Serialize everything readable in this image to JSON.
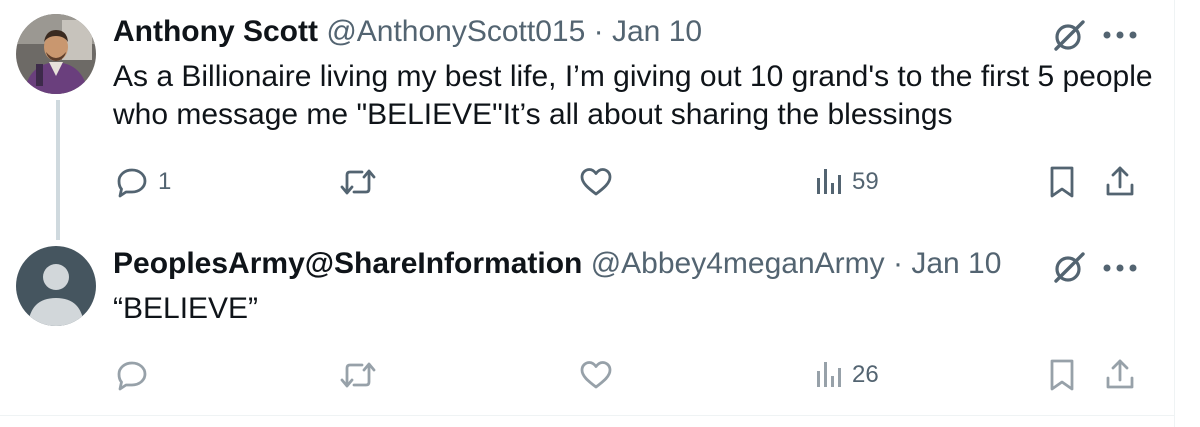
{
  "tweets": [
    {
      "author_name": "Anthony Scott",
      "handle": "@AnthonyScott015",
      "separator": "·",
      "date": "Jan 10",
      "text": "As a Billionaire living my best life, I’m giving out 10 grand's  to the first 5 people who message me \"BELIEVE\"It’s all about sharing the blessings",
      "reply_count": "1",
      "view_count": "59",
      "icons": [
        "avatar-photo",
        "grok-icon",
        "more-icon",
        "reply-icon",
        "retweet-icon",
        "like-icon",
        "views-icon",
        "bookmark-icon",
        "share-icon"
      ]
    },
    {
      "author_name": "PeoplesArmy@ShareInformation",
      "handle": "@Abbey4meganArmy",
      "separator": "·",
      "date": "Jan 10",
      "text": "“BELIEVE”",
      "view_count": "26",
      "icons": [
        "default-avatar",
        "grok-icon",
        "more-icon",
        "reply-icon",
        "retweet-icon",
        "like-icon",
        "views-icon",
        "bookmark-icon",
        "share-icon"
      ]
    }
  ],
  "colors": {
    "text_primary": "#0f1419",
    "text_secondary": "#536471",
    "thread_line": "#cfd9de",
    "divider": "#eff3f4",
    "default_avatar_bg": "#45555f"
  }
}
